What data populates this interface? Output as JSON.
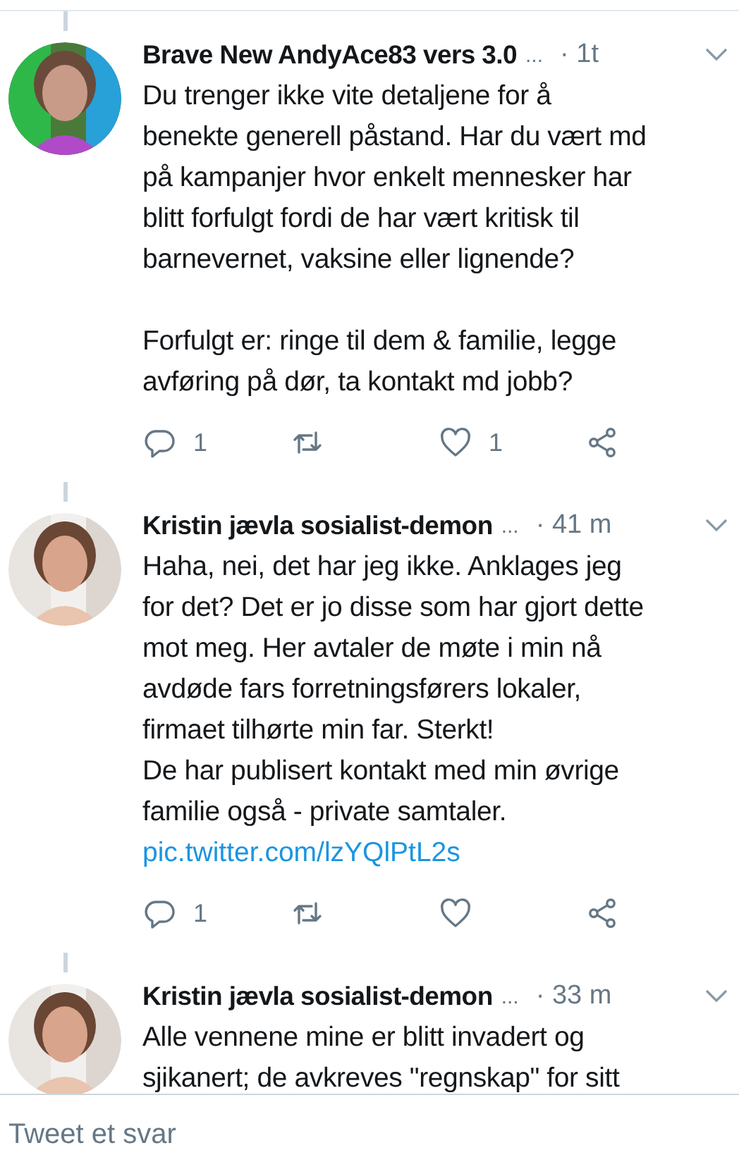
{
  "tweets": [
    {
      "author": "Brave New AndyAce83 vers 3.0",
      "handle": "...",
      "time": "· 1t",
      "avatar": {
        "kind": "picture"
      },
      "paragraphs": [
        "Du trenger ikke vite detaljene for å\nbenekte generell påstand. Har du vært md\npå kampanjer hvor enkelt mennesker har\nblitt forfulgt fordi de har vært kritisk til\nbarnevernet, vaksine eller lignende?",
        "Forfulgt er: ringe til dem & familie, legge\navføring på dør, ta kontakt md jobb?"
      ],
      "actions": [
        {
          "kind": "reply",
          "count": "1"
        },
        {
          "kind": "retweet"
        },
        {
          "kind": "like",
          "count": "1"
        },
        {
          "kind": "share"
        }
      ]
    },
    {
      "author": "Kristin jævla sosialist-demon",
      "handle": "...",
      "time": "· 41 m",
      "avatar": {
        "kind": "picture"
      },
      "paragraphs": [
        "Haha, nei, det har jeg ikke. Anklages jeg\nfor det? Det er jo disse som har gjort dette\nmot meg. Her avtaler de møte i min nå\navdøde fars forretningsførers lokaler,\nfirmaet tilhørte min far. Sterkt!\nDe har publisert kontakt med min øvrige\nfamilie også - private samtaler."
      ],
      "link": "pic.twitter.com/lzYQlPtL2s",
      "actions": [
        {
          "kind": "reply",
          "count": "1"
        },
        {
          "kind": "retweet"
        },
        {
          "kind": "like"
        },
        {
          "kind": "share"
        }
      ]
    },
    {
      "author": "Kristin jævla sosialist-demon",
      "handle": "...",
      "time": "· 33 m",
      "avatar": {
        "kind": "picture"
      },
      "paragraphs": [
        "Alle vennene mine er blitt invadert og\nsjikanert; de avkreves \"regnskap\" for sitt"
      ]
    }
  ],
  "reply_field": {
    "placeholder": "Tweet et svar"
  }
}
